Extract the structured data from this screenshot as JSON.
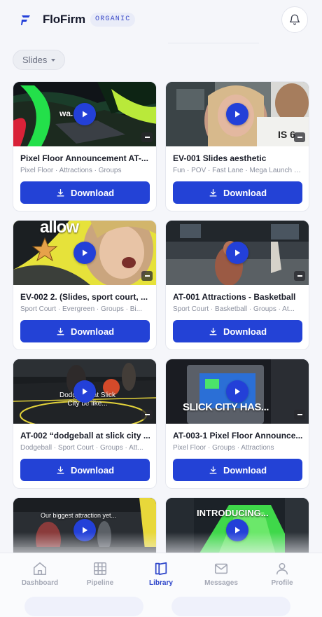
{
  "app": {
    "brand": "FloFirm",
    "tag": "ORGANIC"
  },
  "header": {
    "bell_icon": "bell-icon",
    "logo_icon": "flofirm-logo-icon"
  },
  "filter": {
    "label": "Slides"
  },
  "cards": [
    {
      "title": "Pixel Floor Announcement AT-...",
      "tags": "Pixel Floor · Attractions · Groups",
      "download": "Download",
      "overlay": "wa...it..."
    },
    {
      "title": "EV-001 Slides aesthetic",
      "tags": "Fun · POV · Fast Lane · Mega Launch · ...",
      "download": "Download",
      "overlay": ""
    },
    {
      "title": "EV-002 2. (Slides, sport court, ...",
      "tags": "Sport Court · Evergreen · Groups · Bi...",
      "download": "Download",
      "overlay": "allow"
    },
    {
      "title": "AT-001 Attractions - Basketball",
      "tags": "Sport Court · Basketball · Groups · At...",
      "download": "Download",
      "overlay": ""
    },
    {
      "title": "AT-002 “dodgeball at slick city ...",
      "tags": "Dodgeball · Sport Court · Groups · Att...",
      "download": "Download",
      "overlay": "Dodgeball at Slick City be like..."
    },
    {
      "title": "AT-003-1 Pixel Floor Announce...",
      "tags": "Pixel Floor · Groups · Attractions",
      "download": "Download",
      "overlay": "SLICK CITY HAS..."
    },
    {
      "title": "",
      "tags": "",
      "download": "Download",
      "overlay": "Our biggest attraction yet..."
    },
    {
      "title": "",
      "tags": "",
      "download": "Download",
      "overlay": "INTRODUCING..."
    }
  ],
  "tabs": [
    {
      "label": "Dashboard",
      "icon": "home-icon",
      "active": false
    },
    {
      "label": "Pipeline",
      "icon": "grid-icon",
      "active": false
    },
    {
      "label": "Library",
      "icon": "library-icon",
      "active": true
    },
    {
      "label": "Messages",
      "icon": "mail-icon",
      "active": false
    },
    {
      "label": "Profile",
      "icon": "user-icon",
      "active": false
    }
  ],
  "colors": {
    "accent": "#2342d6",
    "background": "#f5f6fa",
    "active_tab": "#2b43c9"
  }
}
